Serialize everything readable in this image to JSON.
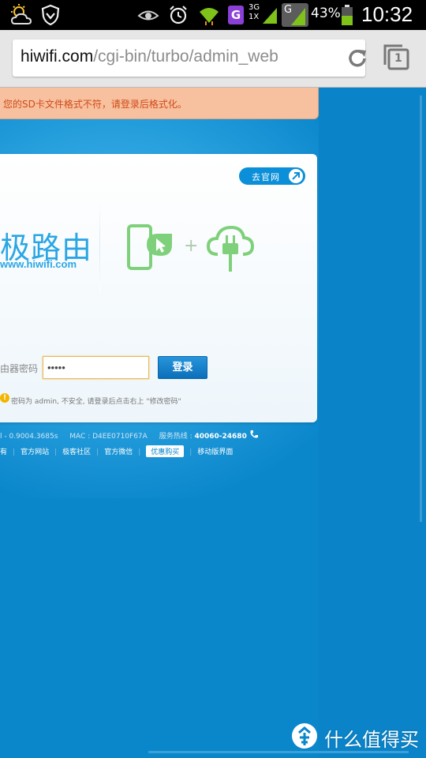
{
  "status_bar": {
    "network_3g": "3G",
    "network_1x": "1X",
    "carrier_g": "G",
    "battery": "43%",
    "time": "10:32",
    "icons": [
      "weather-sun-cloud-icon",
      "shield-icon",
      "eye-icon",
      "alarm-icon",
      "wifi-icon",
      "g-app-icon",
      "signal-icon",
      "battery-icon"
    ]
  },
  "browser": {
    "url_host": "hiwifi.com",
    "url_path": "/cgi-bin/turbo/admin_web",
    "reload_icon": "reload-icon",
    "tabs_count": "1"
  },
  "page": {
    "alert": "您的SD卡文件格式不符，请登录后格式化。",
    "visit_site_label": "去官网",
    "logo_text": "极路由",
    "logo_url": "www.hiwifi.com",
    "plus": "+",
    "password_label": "由器密码",
    "password_value": "•••••",
    "login_label": "登录",
    "warning_icon": "!",
    "warning_text": "密码为 admin, 不安全, 请登录后点击右上 \"修改密码\"",
    "footer": {
      "version": "l - 0.9004.3685s",
      "mac": "MAC : D4EE0710F67A",
      "hotline_label": "服务热线 : ",
      "hotline_number": "40060-24680",
      "links": [
        "有",
        "官方网站",
        "极客社区",
        "官方微信",
        "优惠购买",
        "移动版界面"
      ]
    }
  },
  "watermark": {
    "text": "什么值得买"
  },
  "colors": {
    "page_bg": "#0a86cb",
    "alert_bg": "#f7c09e",
    "alert_text": "#d14a19",
    "brand_blue": "#2aa6e4",
    "illus_green": "#7fd07a"
  }
}
